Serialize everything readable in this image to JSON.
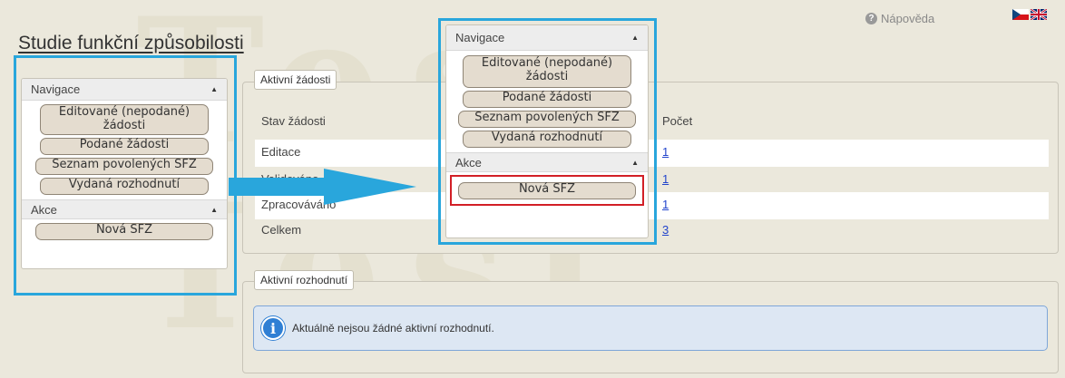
{
  "header": {
    "title": "Studie funkční způsobilosti",
    "help_label": "Nápověda",
    "help_icon": "question-circle-icon",
    "languages": [
      "cs",
      "en"
    ]
  },
  "watermark": "Test",
  "sidebar": {
    "nav_title": "Navigace",
    "nav_items": [
      {
        "label": "Editované (nepodané) žádosti"
      },
      {
        "label": "Podané žádosti"
      },
      {
        "label": "Seznam povolených SFZ"
      },
      {
        "label": "Vydaná rozhodnutí"
      }
    ],
    "actions_title": "Akce",
    "action_items": [
      {
        "label": "Nová SFZ"
      }
    ]
  },
  "active_requests": {
    "legend": "Aktivní žádosti",
    "columns": [
      "Stav žádosti",
      "Počet"
    ],
    "rows": [
      {
        "status": "Editace",
        "count": "1"
      },
      {
        "status": "Validováno",
        "count": "1"
      },
      {
        "status": "Zpracováváno",
        "count": "1"
      },
      {
        "status": "Celkem",
        "count": "3"
      }
    ]
  },
  "active_decisions": {
    "legend": "Aktivní rozhodnutí",
    "message": "Aktuálně nejsou žádné aktivní rozhodnutí."
  },
  "colors": {
    "highlight_border": "#29a6dc",
    "arrow": "#29a6dc",
    "emphasis_box": "#d21f26",
    "background": "#ebe8dc"
  }
}
